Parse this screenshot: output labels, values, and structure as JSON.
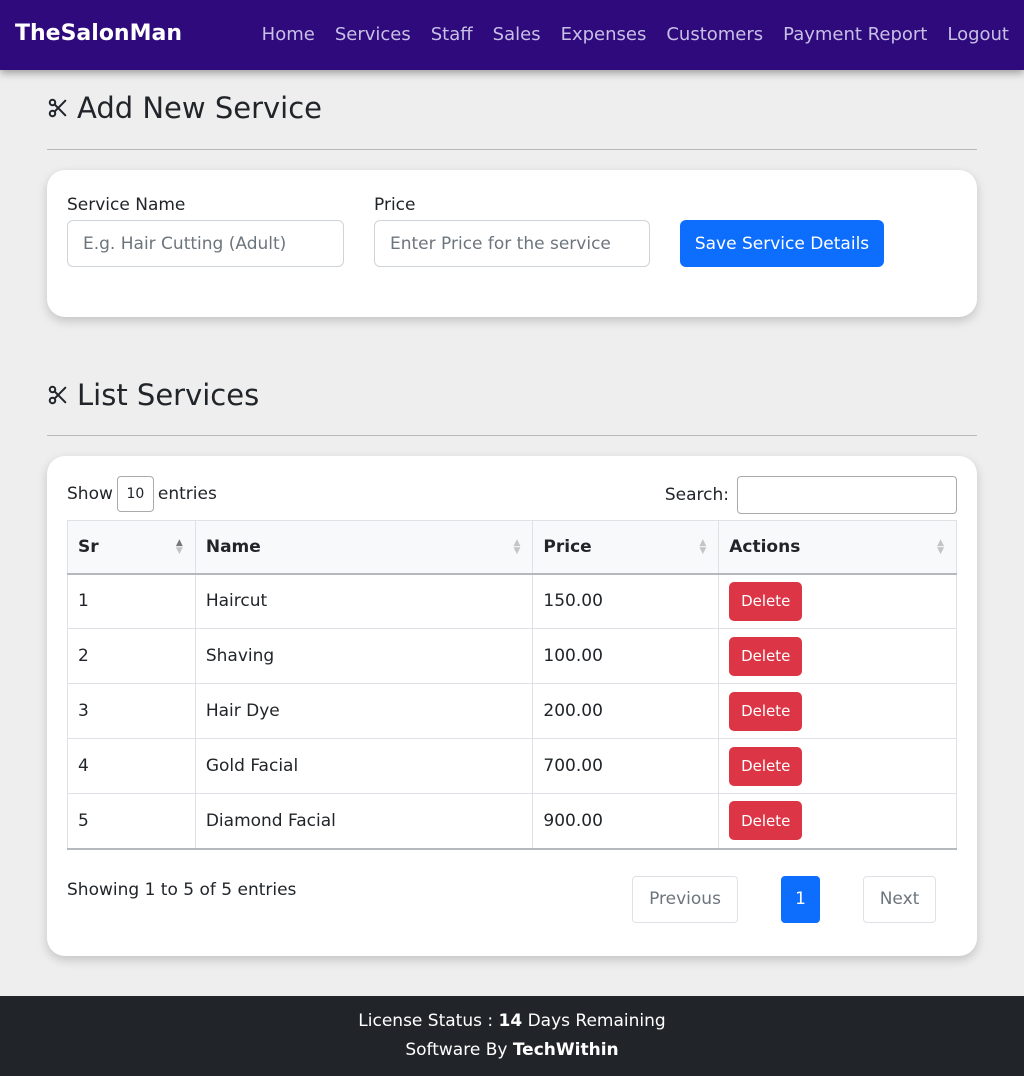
{
  "app": {
    "brand": "TheSalonMan"
  },
  "nav": {
    "items": [
      {
        "label": "Home",
        "name": "nav-home"
      },
      {
        "label": "Services",
        "name": "nav-services"
      },
      {
        "label": "Staff",
        "name": "nav-staff"
      },
      {
        "label": "Sales",
        "name": "nav-sales"
      },
      {
        "label": "Expenses",
        "name": "nav-expenses"
      },
      {
        "label": "Customers",
        "name": "nav-customers"
      },
      {
        "label": "Payment Report",
        "name": "nav-payment-report"
      },
      {
        "label": "Logout",
        "name": "nav-logout"
      }
    ]
  },
  "add_section": {
    "title": "Add New Service",
    "icon": "scissors-icon",
    "service_name_label": "Service Name",
    "service_name_placeholder": "E.g. Hair Cutting (Adult)",
    "service_name_value": "",
    "price_label": "Price",
    "price_placeholder": "Enter Price for the service",
    "price_value": "",
    "save_label": "Save Service Details"
  },
  "list_section": {
    "title": "List Services",
    "icon": "scissors-icon",
    "show_label": "Show",
    "entries_value": "10",
    "entries_label": "entries",
    "search_label": "Search:",
    "search_value": "",
    "columns": [
      "Sr",
      "Name",
      "Price",
      "Actions"
    ],
    "rows": [
      {
        "sr": "1",
        "name": "Haircut",
        "price": "150.00",
        "action": "Delete"
      },
      {
        "sr": "2",
        "name": "Shaving",
        "price": "100.00",
        "action": "Delete"
      },
      {
        "sr": "3",
        "name": "Hair Dye",
        "price": "200.00",
        "action": "Delete"
      },
      {
        "sr": "4",
        "name": "Gold Facial",
        "price": "700.00",
        "action": "Delete"
      },
      {
        "sr": "5",
        "name": "Diamond Facial",
        "price": "900.00",
        "action": "Delete"
      }
    ],
    "info": "Showing 1 to 5 of 5 entries",
    "pagination": {
      "previous": "Previous",
      "current": "1",
      "next": "Next"
    }
  },
  "footer": {
    "license_prefix": "License Status : ",
    "license_days": "14",
    "license_suffix": " Days Remaining",
    "software_prefix": "Software By ",
    "software_company": "TechWithin"
  },
  "colors": {
    "navbar": "#2f0a7c",
    "primary": "#0d6efd",
    "danger": "#dc3545",
    "footer": "#212529",
    "background": "#eeeeee"
  }
}
